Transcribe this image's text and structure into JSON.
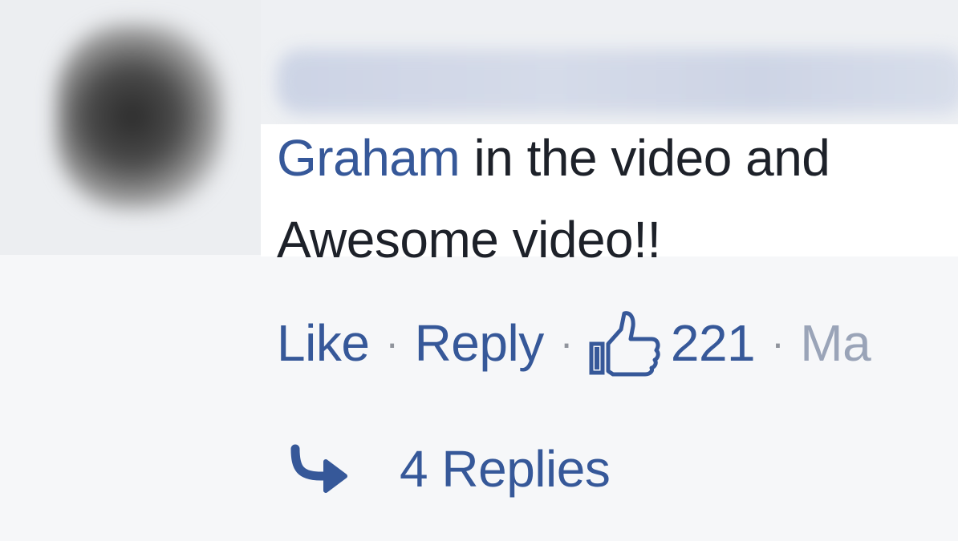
{
  "comment": {
    "mention": "Graham",
    "text_line1_rest": " in the video and",
    "text_line2": "Awesome video!!"
  },
  "actions": {
    "like_label": "Like",
    "separator": "·",
    "reply_label": "Reply",
    "like_count": "221",
    "date_fragment": "Ma"
  },
  "replies": {
    "label": "4 Replies"
  },
  "icons": {
    "like": "thumbs-up-icon",
    "reply_arrow": "reply-arrow-icon"
  },
  "colors": {
    "link": "#365899",
    "text": "#1d2129",
    "muted": "#90949c"
  }
}
